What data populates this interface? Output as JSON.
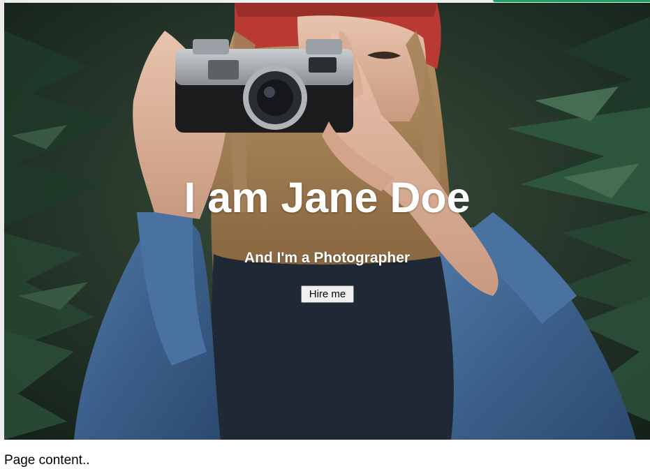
{
  "hero": {
    "title": "I am Jane Doe",
    "subtitle": "And I'm a Photographer",
    "button_label": "Hire me",
    "image": "woman-with-camera-photo"
  },
  "page": {
    "content_text": "Page content.."
  },
  "colors": {
    "hero_text": "#ffffff",
    "button_bg": "#efefef",
    "button_border": "#767676",
    "top_accent": "#1aa260"
  }
}
